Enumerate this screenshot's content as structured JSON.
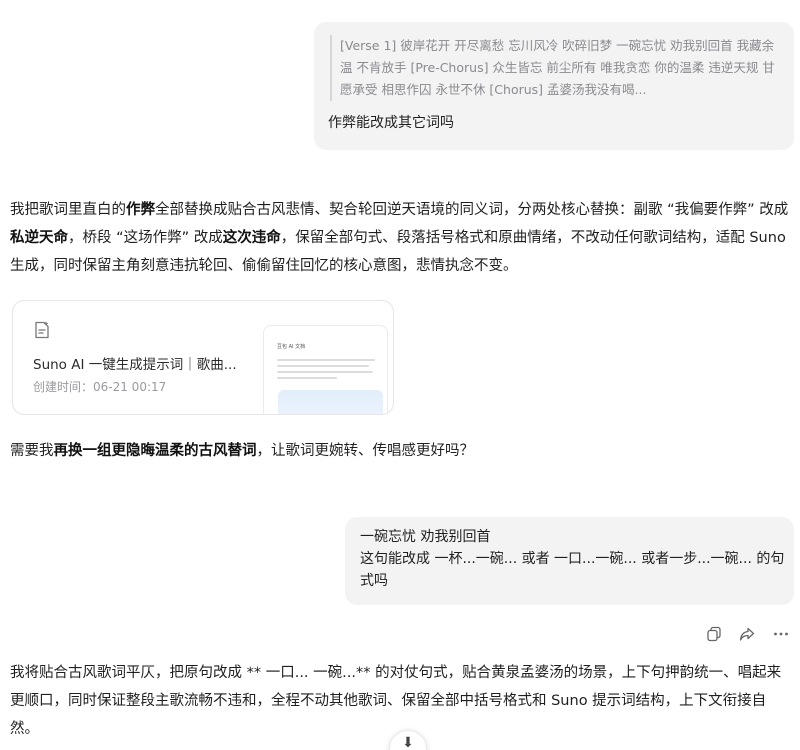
{
  "messages": {
    "user1": {
      "quote": "[Verse 1] 彼岸花开 开尽离愁 忘川风冷 吹碎旧梦 一碗忘忧 劝我别回首 我藏余温 不肯放手 [Pre-Chorus] 众生皆忘 前尘所有 唯我贪恋 你的温柔 违逆天规 甘愿承受 相思作囚 永世不休 [Chorus] 孟婆汤我没有喝...",
      "text": "作弊能改成其它词吗"
    },
    "ai1": {
      "p1_a": "我把歌词里直白的",
      "p1_b1": "作弊",
      "p1_c": "全部替换成贴合古风悲情、契合轮回逆天语境的同义词，分两处核心替换：副歌 “我偏要作弊” 改成",
      "p1_b2": "私逆天命",
      "p1_d": "，桥段 “这场作弊” 改成",
      "p1_b3": "这次违命",
      "p1_e": "，保留全部句式、段落括号格式和原曲情绪，不改动任何歌词结构，适配 Suno 生成，同时保留主角刻意违抗轮回、偷偷留住回忆的核心意图，悲情执念不变。",
      "card": {
        "title": "Suno AI 一键生成提示词｜歌曲...",
        "date": "创建时间：06-21 00:17",
        "preview_title": "豆包 AI 文档"
      },
      "p2_a": "需要我",
      "p2_b": "再换一组更隐晦温柔的古风替词",
      "p2_c": "，让歌词更婉转、传唱感更好吗？"
    },
    "user2": {
      "line1": "一碗忘忧 劝我别回首",
      "line2": "这句能改成 一杯...一碗...   或者 一口...一碗... 或者一步...一碗... 的句式吗"
    },
    "ai2": {
      "text": "我将贴合古风歌词平仄，把原句改成 ** 一口... 一碗...** 的对仗句式，贴合黄泉孟婆汤的场景，上下句押韵统一、唱起来更顺口，同时保证整段主歌流畅不违和，全程不动其他歌词、保留全部中括号格式和 Suno 提示词结构，上下文衔接自然。"
    }
  },
  "icons": [
    "document-icon",
    "copy-icon",
    "share-icon",
    "more-icon",
    "scroll-down-icon"
  ],
  "colors": {
    "bubble_bg": "#f3f3f4",
    "quote_text": "#8a8a8f",
    "text": "#1f1f1f"
  }
}
